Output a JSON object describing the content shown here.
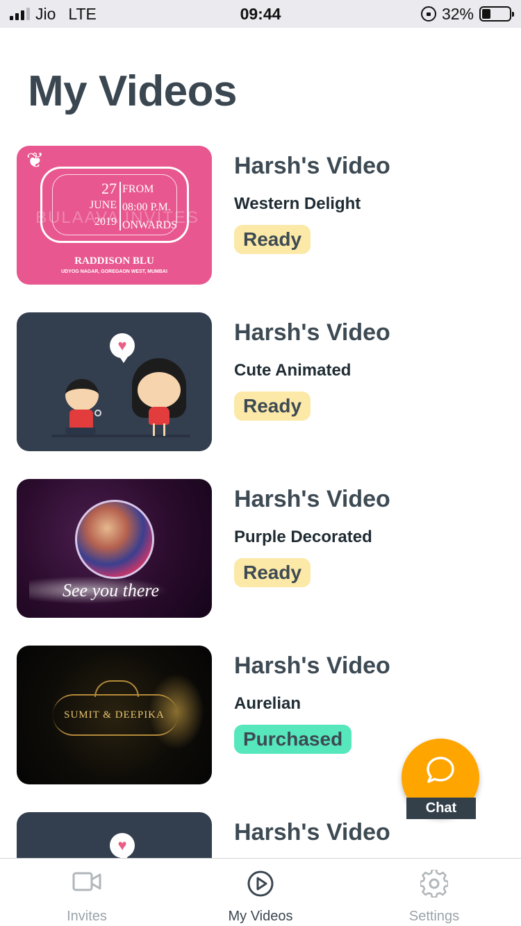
{
  "status_bar": {
    "carrier": "Jio",
    "network": "LTE",
    "time": "09:44",
    "battery": "32%",
    "battery_level": 0.32
  },
  "page": {
    "title": "My Videos"
  },
  "videos": [
    {
      "title": "Harsh's Video",
      "template": "Western Delight",
      "status": "Ready",
      "thumbnail": {
        "day": "27",
        "month": "JUNE",
        "year": "2019",
        "from": "FROM",
        "time": "08:00 P.M.",
        "onwards": "ONWARDS",
        "watermark": "BULAAVA INVITES",
        "venue": "RADDISON BLU",
        "address": "UDYOG NAGAR, GOREGAON WEST, MUMBAI"
      }
    },
    {
      "title": "Harsh's Video",
      "template": "Cute Animated",
      "status": "Ready"
    },
    {
      "title": "Harsh's Video",
      "template": "Purple Decorated",
      "status": "Ready",
      "thumbnail": {
        "script": "See you there"
      }
    },
    {
      "title": "Harsh's Video",
      "template": "Aurelian",
      "status": "Purchased",
      "thumbnail": {
        "names": "SUMIT & DEEPIKA"
      }
    },
    {
      "title": "Harsh's Video"
    }
  ],
  "colors": {
    "ready_badge": "#fce9a8",
    "purchased_badge": "#57e7bd",
    "chat_fab": "#ffa500",
    "title": "#3a4650"
  },
  "chat": {
    "label": "Chat",
    "icon": "chat-bubble-icon"
  },
  "tabs": [
    {
      "label": "Invites",
      "icon": "video-camera-icon",
      "active": false
    },
    {
      "label": "My Videos",
      "icon": "play-circle-icon",
      "active": true
    },
    {
      "label": "Settings",
      "icon": "gear-icon",
      "active": false
    }
  ]
}
